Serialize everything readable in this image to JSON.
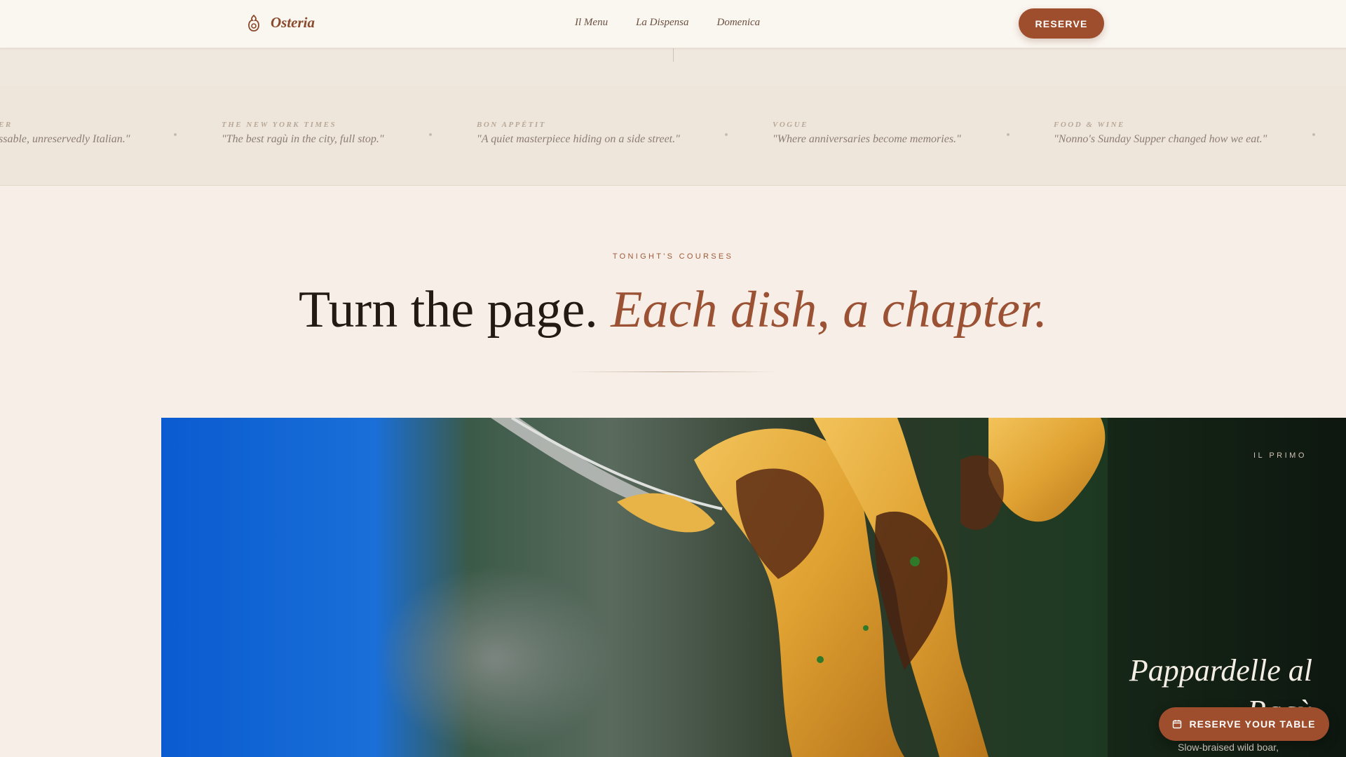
{
  "brand": {
    "name": "Osteria",
    "icon": "flame-pot-icon"
  },
  "nav": {
    "items": [
      "Il Menu",
      "La Dispensa",
      "Domenica"
    ]
  },
  "header": {
    "reserve_label": "RESERVE"
  },
  "press": [
    {
      "source": "ER",
      "quote": "ssable, unreservedly Italian.\""
    },
    {
      "source": "THE NEW YORK TIMES",
      "quote": "\"The best ragù in the city, full stop.\""
    },
    {
      "source": "BON APPÉTIT",
      "quote": "\"A quiet masterpiece hiding on a side street.\""
    },
    {
      "source": "VOGUE",
      "quote": "\"Where anniversaries become memories.\""
    },
    {
      "source": "FOOD & WINE",
      "quote": "\"Nonno's Sunday Supper changed how we eat.\""
    }
  ],
  "section": {
    "eyebrow": "TONIGHT'S COURSES",
    "title_plain": "Turn the page.",
    "title_accent": "Each dish, a chapter."
  },
  "dish": {
    "course": "IL PRIMO",
    "name": "Pappardelle al Ragù",
    "description": "Slow-braised wild boar,"
  },
  "cta": {
    "label": "RESERVE YOUR TABLE",
    "icon": "calendar-icon"
  },
  "colors": {
    "accent": "#9e4d2d",
    "background": "#f7efe7",
    "text": "#231a14"
  }
}
